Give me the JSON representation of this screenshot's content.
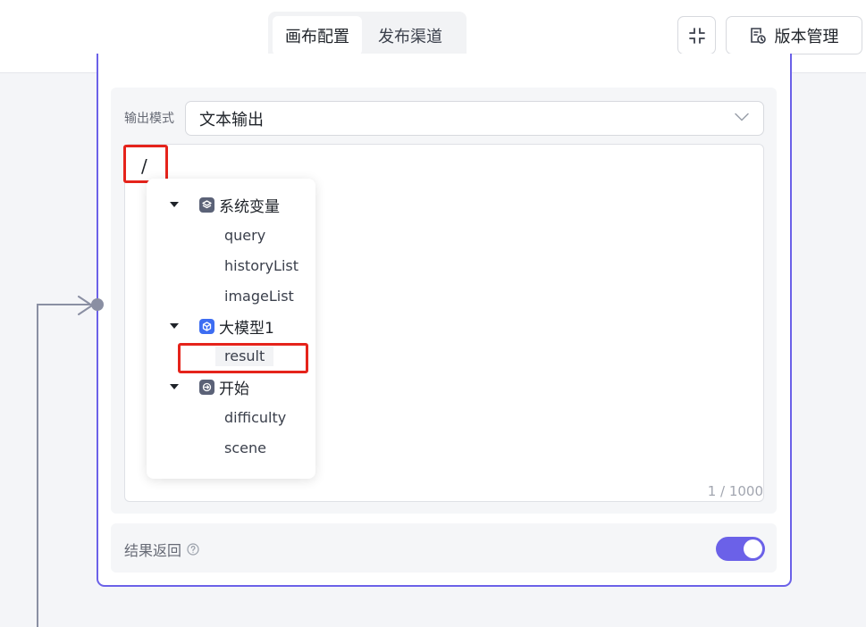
{
  "header": {
    "tabs": [
      {
        "label": "画布配置",
        "active": true
      },
      {
        "label": "发布渠道",
        "active": false
      }
    ],
    "collapse_icon": "collapse-icon",
    "version_button": {
      "label": "版本管理",
      "icon": "version-history-icon"
    }
  },
  "output_node": {
    "mode": {
      "label": "输出模式",
      "value": "文本输出",
      "icon": "chevron-down-icon"
    },
    "editor": {
      "text": "/",
      "counter": "1 / 1000"
    },
    "variable_menu": {
      "groups": [
        {
          "name": "系统变量",
          "icon": "layers-icon",
          "expanded": true,
          "items": [
            "query",
            "historyList",
            "imageList"
          ]
        },
        {
          "name": "大模型1",
          "icon": "model-cube-icon",
          "expanded": true,
          "items": [
            "result"
          ]
        },
        {
          "name": "开始",
          "icon": "start-node-icon",
          "expanded": true,
          "items": [
            "difficulty",
            "scene"
          ]
        }
      ],
      "selected": "result"
    },
    "result_return": {
      "label": "结果返回",
      "help_icon": "help-circle-icon",
      "enabled": true
    }
  },
  "colors": {
    "accent": "#6b61e8",
    "highlight": "#e5231b",
    "connector": "#8a8fa3"
  }
}
